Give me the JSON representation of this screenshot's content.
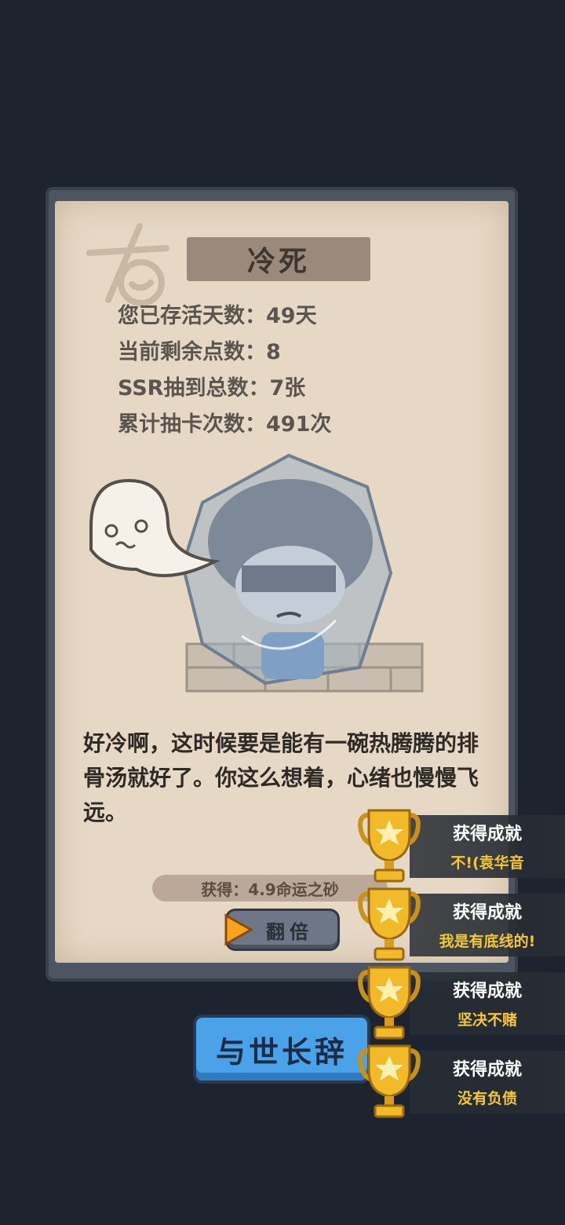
{
  "title": "冷死",
  "stats": [
    "您已存活天数：49天",
    "当前剩余点数：8",
    "SSR抽到总数：7张",
    "累计抽卡次数：491次"
  ],
  "story": "好冷啊，这时候要是能有一碗热腾腾的排骨汤就好了。你这么想着，心绪也慢慢飞远。",
  "reward": "获得：4.9命运之砂",
  "double_button": "翻倍",
  "farewell_button": "与世长辞",
  "achievements": [
    {
      "title": "获得成就",
      "name": "不!(袁华音"
    },
    {
      "title": "获得成就",
      "name": "我是有底线的!"
    },
    {
      "title": "获得成就",
      "name": "坚决不赌"
    },
    {
      "title": "获得成就",
      "name": "没有负债"
    }
  ],
  "colors": {
    "background": "#1d2430",
    "paper": "#e6d8c5",
    "farewell": "#4aa3e8",
    "achievement_name": "#f4c73a"
  }
}
